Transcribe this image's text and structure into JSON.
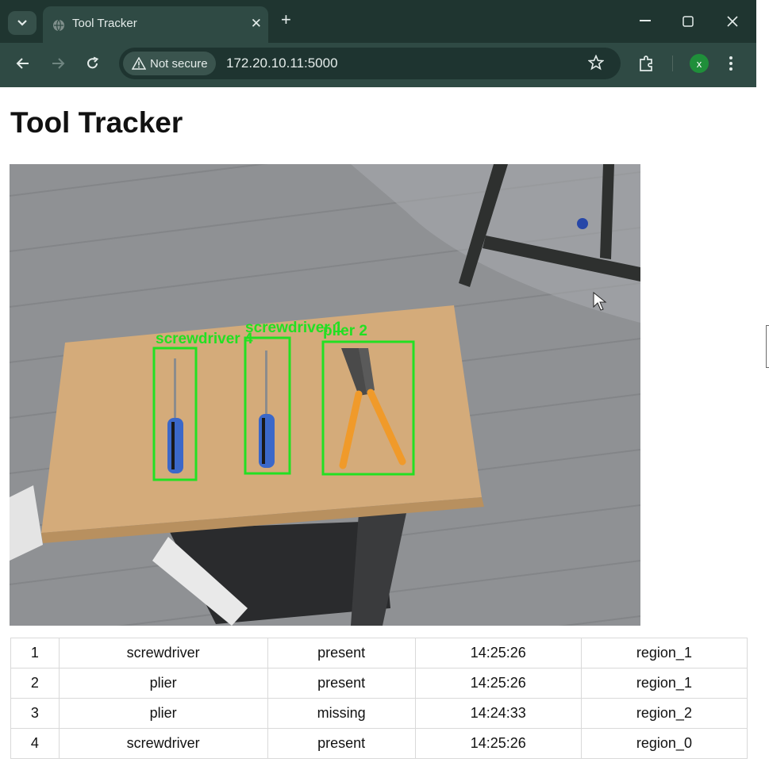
{
  "browser": {
    "tab_title": "Tool Tracker",
    "tab_close": "✕",
    "new_tab": "+",
    "security_label": "Not secure",
    "url": "172.20.10.11:5000",
    "profile_initial": "x"
  },
  "page": {
    "title": "Tool Tracker"
  },
  "camera": {
    "detections": [
      {
        "label": "screwdriver 4"
      },
      {
        "label": "screwdriver 1"
      },
      {
        "label": "plier 2"
      }
    ],
    "box_color": "#22e022"
  },
  "table": {
    "rows": [
      [
        "1",
        "screwdriver",
        "present",
        "14:25:26",
        "region_1"
      ],
      [
        "2",
        "plier",
        "present",
        "14:25:26",
        "region_1"
      ],
      [
        "3",
        "plier",
        "missing",
        "14:24:33",
        "region_2"
      ],
      [
        "4",
        "screwdriver",
        "present",
        "14:25:26",
        "region_0"
      ]
    ]
  },
  "colors": {
    "chrome_dark": "#1f3530",
    "chrome": "#2f4a44",
    "accent_profile": "#1f8f3a"
  }
}
